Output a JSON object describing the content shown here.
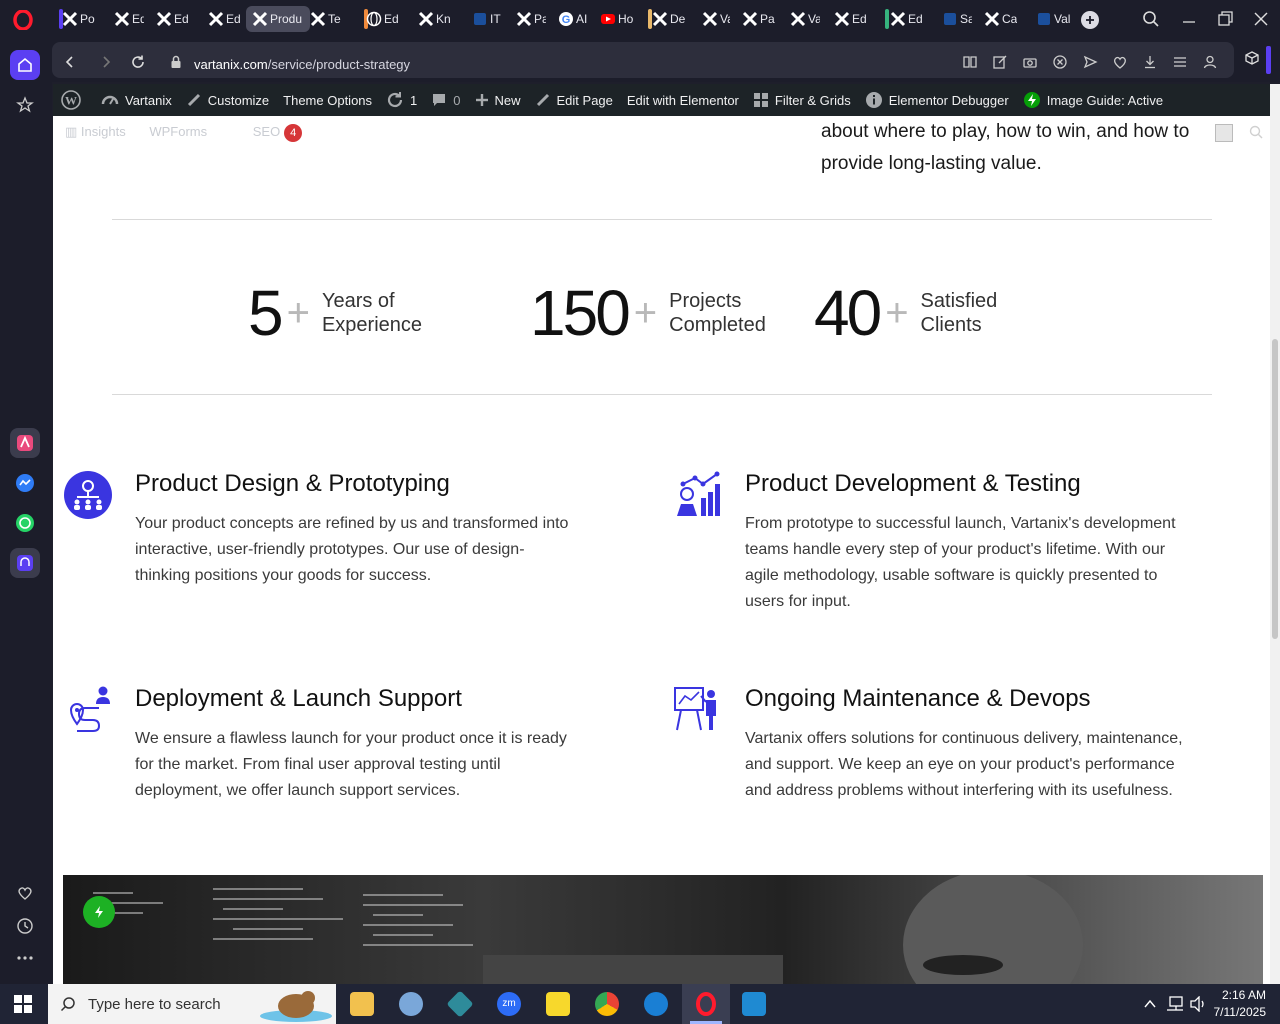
{
  "browser": {
    "tabs": [
      {
        "label": "Po",
        "active": false
      },
      {
        "label": "Ed",
        "active": false
      },
      {
        "label": "Ed",
        "active": false
      },
      {
        "label": "Ed",
        "active": false
      },
      {
        "label": "Produ",
        "active": true
      },
      {
        "label": "Te",
        "active": false
      },
      {
        "label": "Ed",
        "active": false
      },
      {
        "label": "Kn",
        "active": false
      },
      {
        "label": "IT",
        "active": false
      },
      {
        "label": "Pa",
        "active": false
      },
      {
        "label": "AI",
        "active": false
      },
      {
        "label": "Ho",
        "active": false
      },
      {
        "label": "De",
        "active": false
      },
      {
        "label": "Va",
        "active": false
      },
      {
        "label": "Pa",
        "active": false
      },
      {
        "label": "Va",
        "active": false
      },
      {
        "label": "Ed",
        "active": false
      },
      {
        "label": "Ed",
        "active": false
      },
      {
        "label": "Sal",
        "active": false
      },
      {
        "label": "Ca",
        "active": false
      },
      {
        "label": "Val",
        "active": false
      }
    ],
    "url_host": "vartanix.com",
    "url_path": "/service/product-strategy",
    "colors": {
      "frame": "#1c1d2a",
      "accent": "#5b3ff2",
      "active_tab": "#4a4b5c"
    }
  },
  "wp_admin_bar": {
    "site_name": "Vartanix",
    "customize": "Customize",
    "theme_options": "Theme Options",
    "updates_count": "1",
    "comments_count": "0",
    "new": "New",
    "edit_page": "Edit Page",
    "edit_elementor": "Edit with Elementor",
    "filter_grids": "Filter & Grids",
    "elementor_debugger": "Elementor Debugger",
    "image_guide": "Image Guide: Active"
  },
  "overlay": {
    "insights": "Insights",
    "wpforms": "WPForms",
    "seo": "SEO",
    "seo_count": "4"
  },
  "intro": {
    "text_line1": "about where to play, how to win, and how to",
    "text_line2": "provide long-lasting value."
  },
  "stats": [
    {
      "number": "5",
      "plus": "+",
      "label_line1": "Years of",
      "label_line2": "Experience"
    },
    {
      "number": "150",
      "plus": "+",
      "label_line1": "Projects",
      "label_line2": "Completed"
    },
    {
      "number": "40",
      "plus": "+",
      "label_line1": "Satisfied",
      "label_line2": "Clients"
    }
  ],
  "services": [
    {
      "title": "Product Design & Prototyping",
      "desc": "Your product concepts are refined by us and transformed into interactive, user-friendly prototypes. Our use of design-thinking positions your goods for success.",
      "icon": "team-network-icon"
    },
    {
      "title": "Product Development & Testing",
      "desc": "From prototype to successful launch, Vartanix's development teams handle every step of your product's lifetime. With our agile methodology, usable software is quickly presented to users for input.",
      "icon": "analytics-person-icon"
    },
    {
      "title": "Deployment & Launch Support",
      "desc": "We ensure a flawless launch for your product once it is ready for the market. From final user approval testing until deployment, we offer launch support services.",
      "icon": "route-pin-icon"
    },
    {
      "title": "Ongoing Maintenance & Devops",
      "desc": "Vartanix offers solutions for continuous delivery, maintenance, and support. We keep an eye on your product's performance and address problems without interfering with its usefulness.",
      "icon": "presentation-board-icon"
    }
  ],
  "taskbar": {
    "search_placeholder": "Type here to search",
    "time": "2:16 AM",
    "date": "7/11/2025"
  }
}
